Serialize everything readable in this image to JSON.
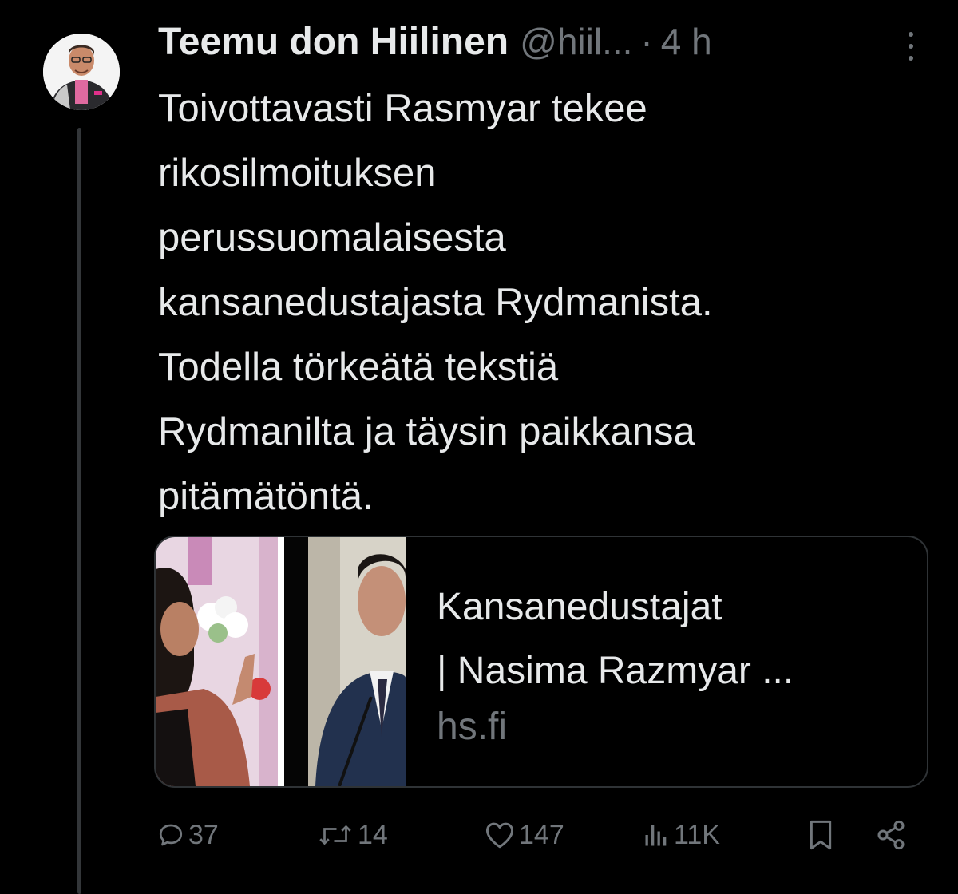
{
  "tweet": {
    "author_name": "Teemu don Hiilinen",
    "handle": "@hiil...",
    "separator": "·",
    "time": "4 h",
    "text_lines": [
      "Toivottavasti Rasmyar tekee",
      "rikosilmoituksen",
      "perussuomalaisesta",
      "kansanedustajasta Rydmanista.",
      "Todella törkeätä tekstiä",
      "Rydmanilta ja täysin paikkansa",
      "pitämätöntä."
    ]
  },
  "link_card": {
    "title_lines": [
      "Kansanedustajat",
      "| Nasima Razmyar ..."
    ],
    "domain": "hs.fi"
  },
  "actions": {
    "replies": "37",
    "retweets": "14",
    "likes": "147",
    "views": "11K"
  },
  "icons": {
    "reply": "reply-icon",
    "retweet": "retweet-icon",
    "like": "heart-icon",
    "views": "views-icon",
    "bookmark": "bookmark-icon",
    "share": "share-icon",
    "more": "more-icon"
  },
  "colors": {
    "background": "#000000",
    "text": "#e7e9ea",
    "muted": "#71767b",
    "border": "#2f3336"
  }
}
